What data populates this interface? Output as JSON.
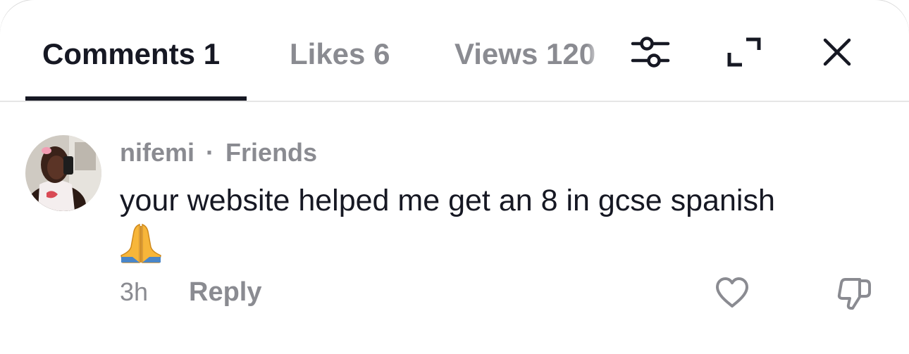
{
  "tabs": {
    "comments": "Comments 1",
    "likes": "Likes 6",
    "views": "Views 120"
  },
  "header_icons": [
    "filter-sliders-icon",
    "expand-icon",
    "close-icon"
  ],
  "comment": {
    "username": "nifemi",
    "separator": "·",
    "relationship": "Friends",
    "text": "your website helped me get an 8 in gcse spanish",
    "emoji": "🙏",
    "time": "3h",
    "reply_label": "Reply",
    "action_icons": [
      "heart-icon",
      "dislike-icon"
    ]
  },
  "colors": {
    "primary_text": "#161823",
    "secondary_text": "#8a8b91",
    "divider": "#e6e6e6",
    "active_tab_underline": "#161823"
  }
}
